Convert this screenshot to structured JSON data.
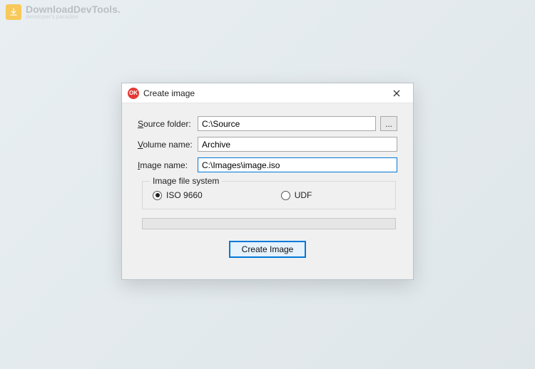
{
  "watermark": {
    "title": "DownloadDevTools.",
    "subtitle": "developer's paradise"
  },
  "window": {
    "title": "Create image",
    "app_icon_text": "OK"
  },
  "form": {
    "source_folder": {
      "label_prefix": "S",
      "label_rest": "ource folder:",
      "value": "C:\\Source",
      "browse_label": "..."
    },
    "volume_name": {
      "label_prefix": "V",
      "label_rest": "olume name:",
      "value": "Archive"
    },
    "image_name": {
      "label_prefix": "I",
      "label_rest": "mage name:",
      "value": "C:\\Images\\image.iso"
    }
  },
  "filesystem": {
    "legend": "Image file system",
    "options": {
      "iso": {
        "prefix": "I",
        "rest": "SO 9660",
        "selected": true
      },
      "udf": {
        "prefix": "U",
        "rest": "DF",
        "selected": false
      }
    }
  },
  "progress": {
    "value": 0
  },
  "buttons": {
    "create_prefix": "C",
    "create_rest": "reate Image"
  }
}
